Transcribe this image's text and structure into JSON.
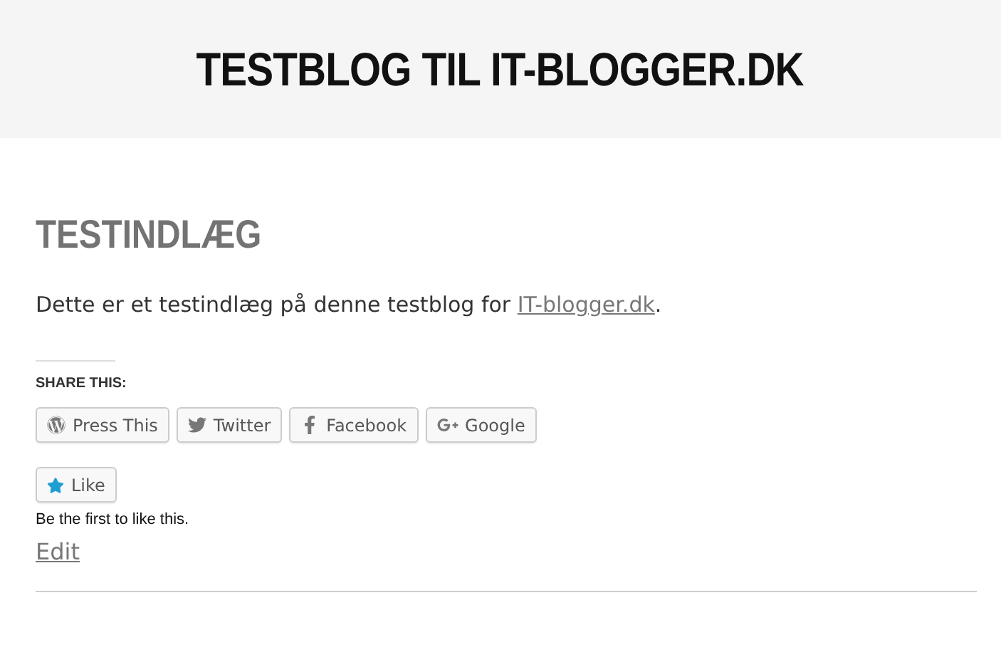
{
  "site": {
    "title": "TESTBLOG TIL IT-BLOGGER.DK"
  },
  "post": {
    "title": "TESTINDLÆG",
    "body": "Dette er et testindlæg på denne testblog for ",
    "link": "IT-blogger.dk",
    "body_end": "."
  },
  "share": {
    "heading": "SHARE THIS:",
    "buttons": [
      {
        "kind": "wordpress",
        "label": "Press This"
      },
      {
        "kind": "twitter",
        "label": "Twitter"
      },
      {
        "kind": "facebook",
        "label": "Facebook"
      },
      {
        "kind": "google",
        "label": "Google"
      }
    ]
  },
  "like": {
    "label": "Like",
    "note": "Be the first to like this."
  },
  "edit": "Edit"
}
